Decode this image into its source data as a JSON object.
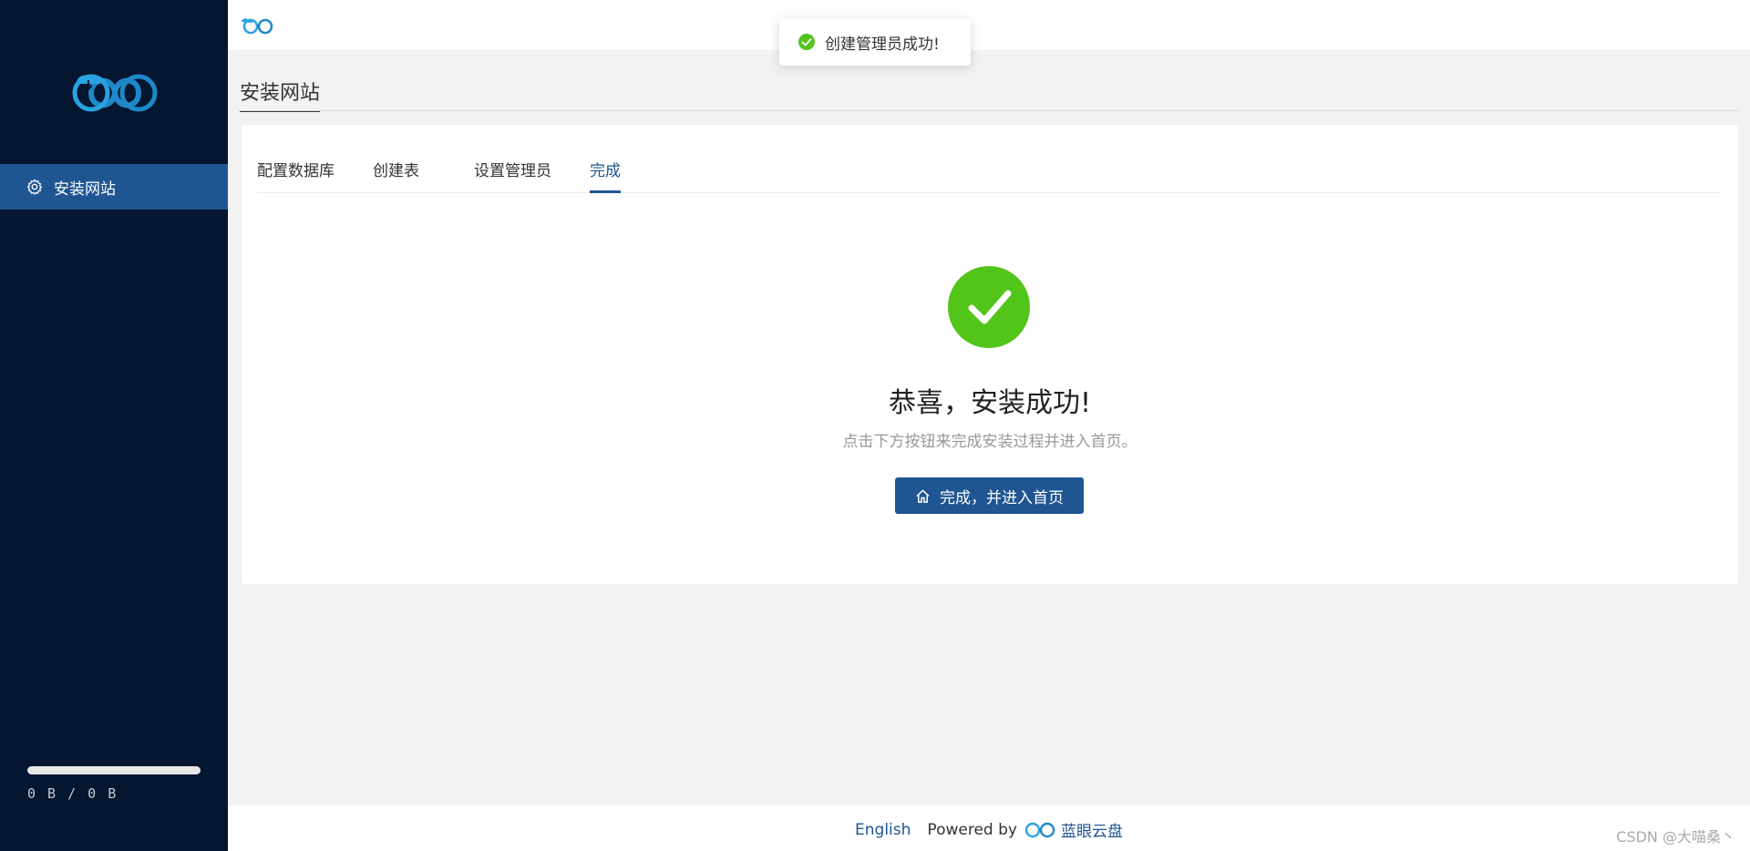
{
  "sidebar": {
    "logo_icon": "blue-eye-cloud-logo",
    "nav_items": [
      {
        "label": "安装网站",
        "icon": "gear-icon",
        "active": true
      }
    ],
    "storage": {
      "used_text": "0 B / 0 B",
      "fraction": 0
    }
  },
  "header": {
    "logo_icon": "blue-eye-logo-small"
  },
  "page": {
    "title": "安装网站"
  },
  "steps": {
    "tabs": [
      {
        "label": "配置数据库"
      },
      {
        "label": "创建表"
      },
      {
        "label": "设置管理员"
      },
      {
        "label": "完成"
      }
    ],
    "active_index": 3
  },
  "result": {
    "icon": "check-circle-icon",
    "title": "恭喜，安装成功!",
    "subtitle": "点击下方按钮来完成安装过程并进入首页。",
    "button_label": "完成，并进入首页",
    "button_icon": "home-icon"
  },
  "toast": {
    "icon": "success-check-icon",
    "message": "创建管理员成功!"
  },
  "footer": {
    "language": "English",
    "powered_by": "Powered by",
    "brand": "蓝眼云盘"
  },
  "watermark": "CSDN @大喵桑丶",
  "colors": {
    "sidebar_bg": "#041630",
    "accent": "#1f5591",
    "success": "#52c41a",
    "page_bg": "#f2f2f2"
  }
}
